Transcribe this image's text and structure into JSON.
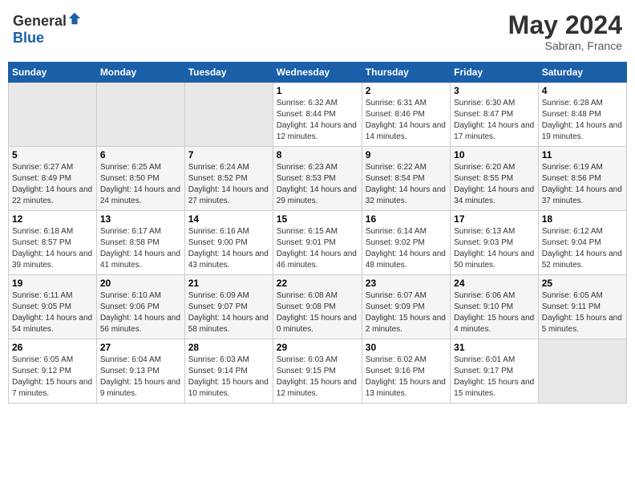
{
  "header": {
    "logo_general": "General",
    "logo_blue": "Blue",
    "month": "May 2024",
    "location": "Sabran, France"
  },
  "weekdays": [
    "Sunday",
    "Monday",
    "Tuesday",
    "Wednesday",
    "Thursday",
    "Friday",
    "Saturday"
  ],
  "weeks": [
    [
      {
        "day": "",
        "info": ""
      },
      {
        "day": "",
        "info": ""
      },
      {
        "day": "",
        "info": ""
      },
      {
        "day": "1",
        "info": "Sunrise: 6:32 AM\nSunset: 8:44 PM\nDaylight: 14 hours and 12 minutes."
      },
      {
        "day": "2",
        "info": "Sunrise: 6:31 AM\nSunset: 8:46 PM\nDaylight: 14 hours and 14 minutes."
      },
      {
        "day": "3",
        "info": "Sunrise: 6:30 AM\nSunset: 8:47 PM\nDaylight: 14 hours and 17 minutes."
      },
      {
        "day": "4",
        "info": "Sunrise: 6:28 AM\nSunset: 8:48 PM\nDaylight: 14 hours and 19 minutes."
      }
    ],
    [
      {
        "day": "5",
        "info": "Sunrise: 6:27 AM\nSunset: 8:49 PM\nDaylight: 14 hours and 22 minutes."
      },
      {
        "day": "6",
        "info": "Sunrise: 6:25 AM\nSunset: 8:50 PM\nDaylight: 14 hours and 24 minutes."
      },
      {
        "day": "7",
        "info": "Sunrise: 6:24 AM\nSunset: 8:52 PM\nDaylight: 14 hours and 27 minutes."
      },
      {
        "day": "8",
        "info": "Sunrise: 6:23 AM\nSunset: 8:53 PM\nDaylight: 14 hours and 29 minutes."
      },
      {
        "day": "9",
        "info": "Sunrise: 6:22 AM\nSunset: 8:54 PM\nDaylight: 14 hours and 32 minutes."
      },
      {
        "day": "10",
        "info": "Sunrise: 6:20 AM\nSunset: 8:55 PM\nDaylight: 14 hours and 34 minutes."
      },
      {
        "day": "11",
        "info": "Sunrise: 6:19 AM\nSunset: 8:56 PM\nDaylight: 14 hours and 37 minutes."
      }
    ],
    [
      {
        "day": "12",
        "info": "Sunrise: 6:18 AM\nSunset: 8:57 PM\nDaylight: 14 hours and 39 minutes."
      },
      {
        "day": "13",
        "info": "Sunrise: 6:17 AM\nSunset: 8:58 PM\nDaylight: 14 hours and 41 minutes."
      },
      {
        "day": "14",
        "info": "Sunrise: 6:16 AM\nSunset: 9:00 PM\nDaylight: 14 hours and 43 minutes."
      },
      {
        "day": "15",
        "info": "Sunrise: 6:15 AM\nSunset: 9:01 PM\nDaylight: 14 hours and 46 minutes."
      },
      {
        "day": "16",
        "info": "Sunrise: 6:14 AM\nSunset: 9:02 PM\nDaylight: 14 hours and 48 minutes."
      },
      {
        "day": "17",
        "info": "Sunrise: 6:13 AM\nSunset: 9:03 PM\nDaylight: 14 hours and 50 minutes."
      },
      {
        "day": "18",
        "info": "Sunrise: 6:12 AM\nSunset: 9:04 PM\nDaylight: 14 hours and 52 minutes."
      }
    ],
    [
      {
        "day": "19",
        "info": "Sunrise: 6:11 AM\nSunset: 9:05 PM\nDaylight: 14 hours and 54 minutes."
      },
      {
        "day": "20",
        "info": "Sunrise: 6:10 AM\nSunset: 9:06 PM\nDaylight: 14 hours and 56 minutes."
      },
      {
        "day": "21",
        "info": "Sunrise: 6:09 AM\nSunset: 9:07 PM\nDaylight: 14 hours and 58 minutes."
      },
      {
        "day": "22",
        "info": "Sunrise: 6:08 AM\nSunset: 9:08 PM\nDaylight: 15 hours and 0 minutes."
      },
      {
        "day": "23",
        "info": "Sunrise: 6:07 AM\nSunset: 9:09 PM\nDaylight: 15 hours and 2 minutes."
      },
      {
        "day": "24",
        "info": "Sunrise: 6:06 AM\nSunset: 9:10 PM\nDaylight: 15 hours and 4 minutes."
      },
      {
        "day": "25",
        "info": "Sunrise: 6:05 AM\nSunset: 9:11 PM\nDaylight: 15 hours and 5 minutes."
      }
    ],
    [
      {
        "day": "26",
        "info": "Sunrise: 6:05 AM\nSunset: 9:12 PM\nDaylight: 15 hours and 7 minutes."
      },
      {
        "day": "27",
        "info": "Sunrise: 6:04 AM\nSunset: 9:13 PM\nDaylight: 15 hours and 9 minutes."
      },
      {
        "day": "28",
        "info": "Sunrise: 6:03 AM\nSunset: 9:14 PM\nDaylight: 15 hours and 10 minutes."
      },
      {
        "day": "29",
        "info": "Sunrise: 6:03 AM\nSunset: 9:15 PM\nDaylight: 15 hours and 12 minutes."
      },
      {
        "day": "30",
        "info": "Sunrise: 6:02 AM\nSunset: 9:16 PM\nDaylight: 15 hours and 13 minutes."
      },
      {
        "day": "31",
        "info": "Sunrise: 6:01 AM\nSunset: 9:17 PM\nDaylight: 15 hours and 15 minutes."
      },
      {
        "day": "",
        "info": ""
      }
    ]
  ]
}
